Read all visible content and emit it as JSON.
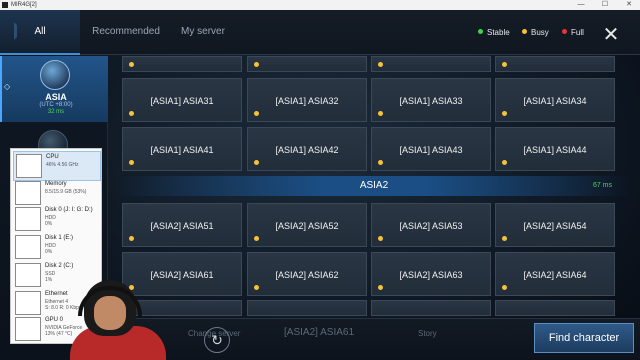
{
  "window": {
    "title": "MIR4G[2]",
    "controls": [
      "—",
      "☐",
      "✕"
    ]
  },
  "tabs": {
    "all": "All",
    "recommended": "Recommended",
    "my_server": "My server"
  },
  "legend": {
    "stable": {
      "label": "Stable",
      "color": "#3fd24a"
    },
    "busy": {
      "label": "Busy",
      "color": "#f5c23a"
    },
    "full": {
      "label": "Full",
      "color": "#e8353a"
    }
  },
  "close_icon": "✕",
  "sidebar": {
    "region_name": "ASIA",
    "region_utc": "(UTC +8:00)",
    "region_ping": "32 ms",
    "region_arrow": "◇"
  },
  "asia1": {
    "partial_row_status": [
      "busy",
      "busy",
      "busy",
      "busy"
    ],
    "row1": [
      {
        "name": "[ASIA1] ASIA31",
        "status": "busy"
      },
      {
        "name": "[ASIA1] ASIA32",
        "status": "busy"
      },
      {
        "name": "[ASIA1] ASIA33",
        "status": "busy"
      },
      {
        "name": "[ASIA1] ASIA34",
        "status": "busy"
      }
    ],
    "row2": [
      {
        "name": "[ASIA1] ASIA41",
        "status": "busy"
      },
      {
        "name": "[ASIA1] ASIA42",
        "status": "busy"
      },
      {
        "name": "[ASIA1] ASIA43",
        "status": "busy"
      },
      {
        "name": "[ASIA1] ASIA44",
        "status": "busy"
      }
    ]
  },
  "asia2": {
    "header": "ASIA2",
    "ping": "67 ms",
    "row1": [
      {
        "name": "[ASIA2] ASIA51",
        "status": "busy"
      },
      {
        "name": "[ASIA2] ASIA52",
        "status": "busy"
      },
      {
        "name": "[ASIA2] ASIA53",
        "status": "busy"
      },
      {
        "name": "[ASIA2] ASIA54",
        "status": "busy"
      }
    ],
    "row2": [
      {
        "name": "[ASIA2] ASIA61",
        "status": "busy"
      },
      {
        "name": "[ASIA2] ASIA62",
        "status": "busy"
      },
      {
        "name": "[ASIA2] ASIA63",
        "status": "busy"
      },
      {
        "name": "[ASIA2] ASIA64",
        "status": "busy"
      }
    ]
  },
  "bottom": {
    "faded_left": "Change server",
    "faded_center": "[ASIA2] ASIA61",
    "faded_right": "Story",
    "refresh_icon": "↻",
    "find_button": "Find character"
  },
  "perf_overlay": {
    "items": [
      {
        "name": "CPU",
        "sub": "46% 4.56 GHz",
        "sub2": ""
      },
      {
        "name": "Memory",
        "sub": "8.5/15.9 GB (53%)",
        "sub2": ""
      },
      {
        "name": "Disk 0 (J: I: G: D:)",
        "sub": "HDD",
        "sub2": "0%"
      },
      {
        "name": "Disk 1 (E:)",
        "sub": "HDD",
        "sub2": "0%"
      },
      {
        "name": "Disk 2 (C:)",
        "sub": "SSD",
        "sub2": "1%"
      },
      {
        "name": "Ethernet",
        "sub": "Ethernet 4",
        "sub2": "S: 8.0 R: 0 Kbps"
      },
      {
        "name": "GPU 0",
        "sub": "NVIDIA GeForce",
        "sub2": "13% (47 °C)"
      }
    ]
  }
}
